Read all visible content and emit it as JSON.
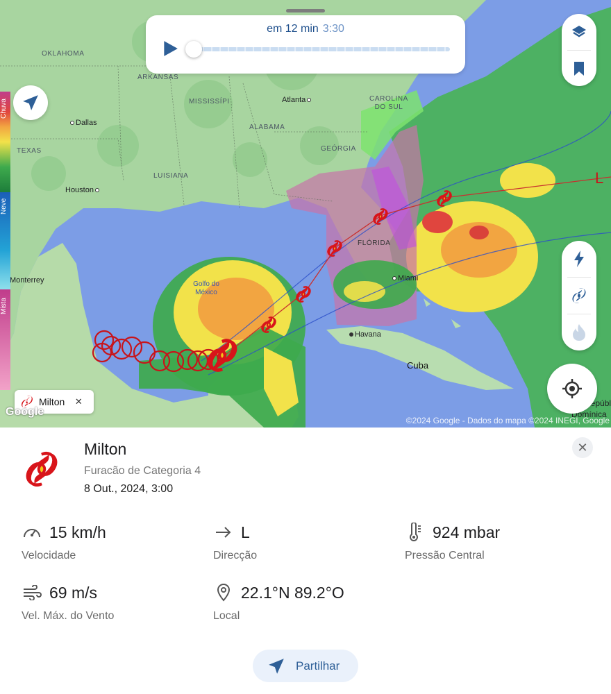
{
  "map": {
    "states": [
      "OKLAHOMA",
      "ARKANSAS",
      "MISSISSÍPI",
      "ALABAMA",
      "CAROLINA DO SUL",
      "TEXAS",
      "LUISIANA",
      "GEÓRGIA",
      "FLÓRIDA"
    ],
    "cities": [
      "Dallas",
      "Houston",
      "Atlanta",
      "Miami",
      "Havana",
      "Monterrey"
    ],
    "gulf_label": "Golfo do México",
    "countries": [
      "Cuba",
      "Repúbli",
      "Domínica"
    ],
    "pressure_label": "L",
    "attribution": "©2024 Google - Dados do mapa ©2024 INEGI, Google",
    "google_logo": "Google"
  },
  "legend": {
    "rain": "Chuva",
    "snow": "Neve",
    "mixed": "Mista"
  },
  "playback": {
    "time_label": "em 12 min",
    "clock": "3:30",
    "progress": 0.0
  },
  "icons": {
    "play": "play-icon",
    "locate": "navigate-arrow-icon",
    "layers": "layers-icon",
    "bookmark": "bookmark-icon",
    "lightning": "lightning-icon",
    "hurricane": "hurricane-icon",
    "fire": "fire-icon",
    "gps": "crosshair-icon"
  },
  "chip": {
    "category": "4",
    "name": "Milton",
    "close": "✕"
  },
  "storm": {
    "name": "Milton",
    "category": "Furacão de Categoria 4",
    "date": "8 Out., 2024, 3:00",
    "close": "✕"
  },
  "stats": {
    "speed": {
      "value": "15 km/h",
      "label": "Velocidade"
    },
    "direction": {
      "value": "L",
      "label": "Direcção"
    },
    "pressure": {
      "value": "924 mbar",
      "label": "Pressão Central"
    },
    "wind": {
      "value": "69 m/s",
      "label": "Vel. Máx. do Vento"
    },
    "location": {
      "value": "22.1°N 89.2°O",
      "label": "Local"
    }
  },
  "share": {
    "label": "Partilhar"
  },
  "colors": {
    "accent": "#2e5f97",
    "hurricane_red": "#d8141a",
    "hurricane_yellow": "#f5c518"
  }
}
